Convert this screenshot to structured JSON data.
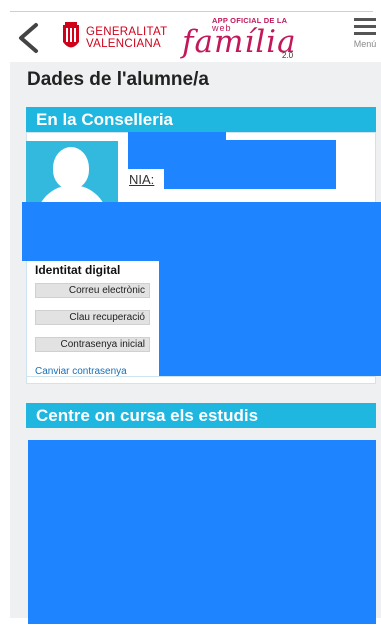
{
  "header": {
    "back_icon": "chevron-left-icon",
    "gv_logo": {
      "line1": "GENERALITAT",
      "line2": "VALENCIANA"
    },
    "wf_logo": {
      "tagline": "APP OFICIAL DE LA",
      "web": "web",
      "name": "família",
      "version": "2.0"
    },
    "menu_label": "Menú"
  },
  "page": {
    "title": "Dades de l'alumne/a",
    "section1_title": "En la Conselleria",
    "nia_label": "NIA:",
    "identity": {
      "title": "Identitat digital",
      "email_button": "Correu electrònic",
      "recovery_button": "Clau recuperació",
      "initial_password_button": "Contrasenya inicial",
      "change_password_link": "Canviar contrasenya"
    },
    "section2_title": "Centre on cursa els estudis"
  },
  "colors": {
    "section_header": "#1fb6e0",
    "redaction": "#1f84ff",
    "brand_red": "#d0021b",
    "brand_pink": "#c2185b"
  }
}
